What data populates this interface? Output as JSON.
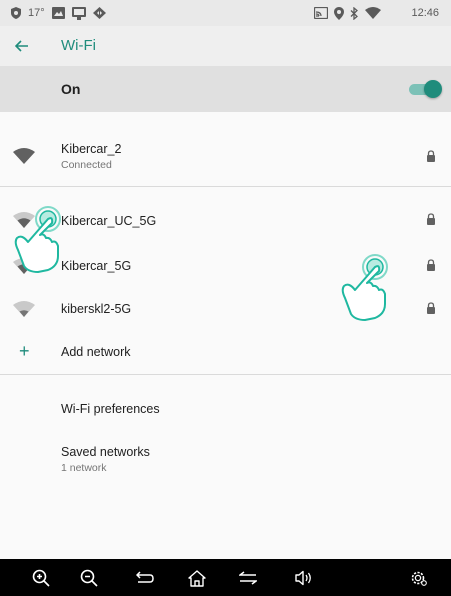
{
  "status_bar": {
    "left_icons": [
      "shield-icon",
      "temperature-icon",
      "image-icon",
      "screen-icon",
      "code-icon"
    ],
    "temperature": "17°",
    "right_icons": [
      "cast-icon",
      "location-icon",
      "bluetooth-icon",
      "wifi-signal-icon"
    ],
    "time": "12:46"
  },
  "toolbar": {
    "title": "Wi-Fi",
    "back_icon": "arrow-left-icon"
  },
  "master_switch": {
    "label": "On",
    "state": true
  },
  "connected": {
    "name": "Kibercar_2",
    "status": "Connected"
  },
  "networks": [
    {
      "name": "Kibercar_UC_5G",
      "secured": true
    },
    {
      "name": "Kibercar_5G",
      "secured": true
    },
    {
      "name": "kiberskl2-5G",
      "secured": true
    }
  ],
  "add_network": {
    "label": "Add network"
  },
  "preferences": {
    "label": "Wi-Fi preferences"
  },
  "saved": {
    "label": "Saved networks",
    "sub": "1 network"
  },
  "nav_bar": {
    "buttons": [
      "zoom-in-icon",
      "zoom-out-icon",
      "back-icon",
      "home-icon",
      "recents-icon",
      "volume-icon",
      "settings-icon"
    ]
  },
  "colors": {
    "accent": "#1f8c7c",
    "status_bar": "#e9e9e9",
    "master_bg": "#e0e0e0",
    "nav_bar": "#000000",
    "gesture_hand": "#1fb8a0"
  }
}
